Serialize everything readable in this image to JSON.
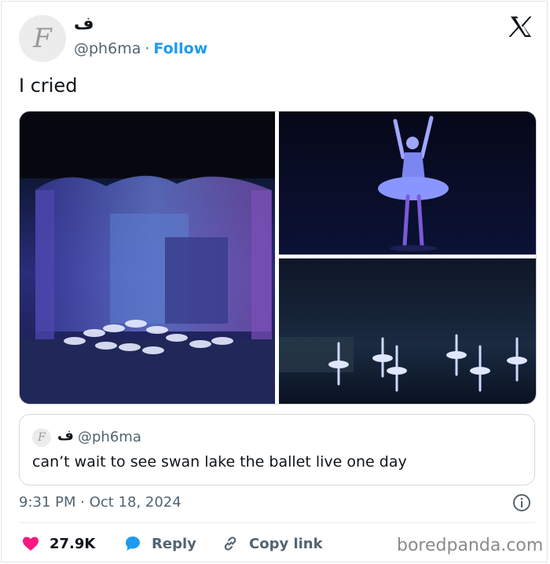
{
  "author": {
    "display_name": "ف",
    "avatar_letter": "F",
    "handle": "@ph6ma",
    "separator": "·",
    "follow_label": "Follow"
  },
  "tweet": {
    "text": "I cried",
    "timestamp": "9:31 PM · Oct 18, 2024"
  },
  "media": {
    "photos": [
      "ballet-corps-stage-photo",
      "ballet-soloist-photo",
      "ballet-line-photo"
    ]
  },
  "quoted_tweet": {
    "display_name": "ف",
    "handle": "@ph6ma",
    "text": "can’t wait to see swan lake the ballet live one day"
  },
  "actions": {
    "likes": "27.9K",
    "reply_label": "Reply",
    "copy_link_label": "Copy link"
  },
  "watermark": "boredpanda.com",
  "colors": {
    "follow_blue": "#1d9bf0",
    "heart_red": "#f91880",
    "reply_blue": "#1d9bf0",
    "secondary_text": "#536471"
  },
  "icons": [
    "x-logo-icon",
    "info-icon",
    "heart-icon",
    "reply-bubble-icon",
    "link-icon"
  ]
}
